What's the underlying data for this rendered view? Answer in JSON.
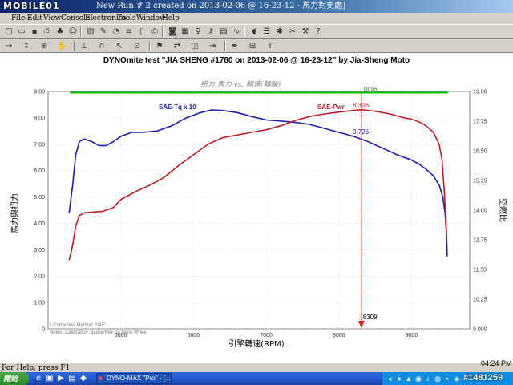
{
  "window": {
    "logo": "MOBILE01",
    "title": "New Run # 2 created on 2013-02-06 @ 16-23-12 - 馬力對史處]"
  },
  "menu": [
    "File",
    "Edit",
    "View",
    "Console",
    "Electronics",
    "Tools",
    "Window",
    "Help"
  ],
  "toolbar1_icons": [
    "new-file-icon",
    "open-folder-icon",
    "save-icon",
    "print-icon",
    "tree-icon",
    "people-icon",
    "chart-icon",
    "wrench-icon",
    "gauge-icon",
    "stack-icon",
    "book-icon",
    "printer-icon",
    "camera-icon",
    "grid-icon",
    "bulb-icon",
    "key-icon",
    "table-icon",
    "chart-line-icon",
    "mouse-icon",
    "list-icon",
    "settings-icon",
    "tools-icon",
    "hammer-icon",
    "help-icon"
  ],
  "toolbar2_icons": [
    "arrow-icon",
    "marker-icon",
    "zoom-icon",
    "hand-icon",
    "ruler-icon",
    "curve-icon",
    "cursor-icon",
    "magnify-icon",
    "flag-icon",
    "compare-icon",
    "overlay-icon",
    "export-icon",
    "pen-icon",
    "grid2-icon",
    "text-icon"
  ],
  "status": {
    "help": "For Help, press F1",
    "clock": "04:24 PM"
  },
  "taskbar": {
    "start": "開始",
    "task_label": "DYNO-MAX \"Pro\" - [...",
    "watermark": "#1481259"
  },
  "colors": {
    "torque": "#1c1cb4",
    "power": "#c01c28",
    "marker": "#e02020",
    "reference": "#00c000"
  },
  "chart_data": {
    "type": "line",
    "title": "DYNOmite test \"JIA SHENG #1780 on 2013-02-06 @ 16-23-12\" by Jia-Sheng Moto",
    "subtitle": "扭力 馬力 vs. 轉速(轉輪)",
    "xlabel": "引擎轉速(RPM)",
    "ylabel": "馬力與扭力",
    "y2label": "空燃比",
    "xlim": [
      4000,
      9800
    ],
    "ylim": [
      0,
      9.0
    ],
    "y2lim": [
      9.0,
      19.0
    ],
    "x_ticks": [
      5000,
      6000,
      7000,
      8000,
      9000
    ],
    "y_ticks": [
      "0",
      "1.00",
      "2.00",
      "3.00",
      "4.00",
      "5.00",
      "6.00",
      "7.00",
      "8.00",
      "9.00"
    ],
    "y2_ticks": [
      "9.000",
      "10.25",
      "11.50",
      "12.75",
      "14.00",
      "15.25",
      "16.50",
      "17.75",
      "19.00"
    ],
    "reference_line": {
      "value": 18.95,
      "label": "18.95"
    },
    "marker": {
      "x": 8309,
      "label": "8309"
    },
    "notes": [
      "* Correction Method: SAE",
      "Notes: Calibration 3pulse/Rev on Dyno Wheel"
    ],
    "series": [
      {
        "name": "SAE-Tq x 10",
        "value_label": "0.726",
        "points": [
          [
            4290,
            4.4
          ],
          [
            4340,
            5.5
          ],
          [
            4380,
            6.6
          ],
          [
            4430,
            7.1
          ],
          [
            4500,
            7.2
          ],
          [
            4600,
            7.1
          ],
          [
            4700,
            6.95
          ],
          [
            4800,
            6.95
          ],
          [
            4900,
            7.1
          ],
          [
            5000,
            7.3
          ],
          [
            5150,
            7.45
          ],
          [
            5300,
            7.45
          ],
          [
            5500,
            7.5
          ],
          [
            5700,
            7.7
          ],
          [
            5900,
            8.0
          ],
          [
            6100,
            8.2
          ],
          [
            6250,
            8.3
          ],
          [
            6400,
            8.28
          ],
          [
            6600,
            8.2
          ],
          [
            6800,
            8.05
          ],
          [
            7000,
            7.92
          ],
          [
            7200,
            7.88
          ],
          [
            7400,
            7.83
          ],
          [
            7600,
            7.75
          ],
          [
            7800,
            7.6
          ],
          [
            8000,
            7.45
          ],
          [
            8200,
            7.3
          ],
          [
            8400,
            7.1
          ],
          [
            8600,
            6.85
          ],
          [
            8800,
            6.6
          ],
          [
            9000,
            6.4
          ],
          [
            9100,
            6.25
          ],
          [
            9200,
            6.05
          ],
          [
            9300,
            5.8
          ],
          [
            9380,
            5.45
          ],
          [
            9430,
            5.0
          ],
          [
            9460,
            4.4
          ],
          [
            9480,
            3.6
          ],
          [
            9490,
            2.75
          ]
        ]
      },
      {
        "name": "SAE-Pwr",
        "value_label": "8.306",
        "points": [
          [
            4290,
            2.6
          ],
          [
            4340,
            3.2
          ],
          [
            4380,
            3.9
          ],
          [
            4430,
            4.3
          ],
          [
            4500,
            4.4
          ],
          [
            4600,
            4.42
          ],
          [
            4750,
            4.45
          ],
          [
            4900,
            4.6
          ],
          [
            5000,
            4.9
          ],
          [
            5200,
            5.2
          ],
          [
            5400,
            5.45
          ],
          [
            5600,
            5.75
          ],
          [
            5800,
            6.2
          ],
          [
            6000,
            6.6
          ],
          [
            6200,
            7.0
          ],
          [
            6400,
            7.25
          ],
          [
            6600,
            7.35
          ],
          [
            6800,
            7.45
          ],
          [
            7000,
            7.55
          ],
          [
            7200,
            7.7
          ],
          [
            7400,
            7.9
          ],
          [
            7600,
            8.05
          ],
          [
            7800,
            8.15
          ],
          [
            8000,
            8.22
          ],
          [
            8200,
            8.28
          ],
          [
            8309,
            8.306
          ],
          [
            8500,
            8.25
          ],
          [
            8700,
            8.15
          ],
          [
            8900,
            8.0
          ],
          [
            9000,
            7.95
          ],
          [
            9100,
            7.85
          ],
          [
            9200,
            7.7
          ],
          [
            9300,
            7.45
          ],
          [
            9380,
            7.0
          ],
          [
            9420,
            6.4
          ],
          [
            9450,
            5.2
          ],
          [
            9470,
            4.2
          ],
          [
            9480,
            3.6
          ]
        ]
      }
    ]
  }
}
